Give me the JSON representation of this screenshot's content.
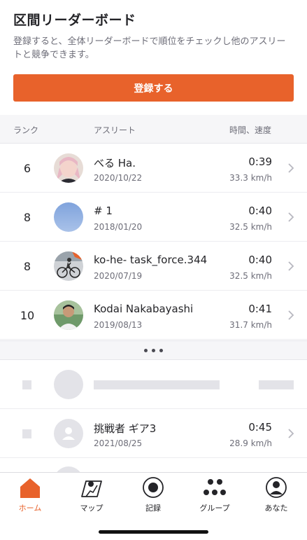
{
  "promo": {
    "title": "区間リーダーボード",
    "description": "登録すると、全体リーダーボードで順位をチェックし他のアスリートと競争できます。",
    "register_label": "登録する"
  },
  "columns": {
    "rank": "ランク",
    "athlete": "アスリート",
    "time_speed": "時間、速度"
  },
  "rows": [
    {
      "rank": "6",
      "name": "べる Ha.",
      "date": "2020/10/22",
      "time": "0:39",
      "speed": "33.3 km/h",
      "avatar": "anime-character-avatar"
    },
    {
      "rank": "8",
      "name": "# 1",
      "date": "2018/01/20",
      "time": "0:40",
      "speed": "32.5 km/h",
      "avatar": "sky-avatar"
    },
    {
      "rank": "8",
      "name": "ko-he- task_force.344",
      "date": "2020/07/19",
      "time": "0:40",
      "speed": "32.5 km/h",
      "avatar": "cyclist-avatar"
    },
    {
      "rank": "10",
      "name": "Kodai Nakabayashi",
      "date": "2019/08/13",
      "time": "0:41",
      "speed": "31.7 km/h",
      "avatar": "person-avatar"
    }
  ],
  "challenger": {
    "name": "挑戦者 ギア3",
    "date": "2021/08/25",
    "time": "0:45",
    "speed": "28.9 km/h"
  },
  "tabs": [
    {
      "label": "ホーム",
      "icon": "home-icon",
      "active": true
    },
    {
      "label": "マップ",
      "icon": "map-icon",
      "active": false
    },
    {
      "label": "記録",
      "icon": "record-icon",
      "active": false
    },
    {
      "label": "グループ",
      "icon": "groups-icon",
      "active": false
    },
    {
      "label": "あなた",
      "icon": "profile-icon",
      "active": false
    }
  ],
  "colors": {
    "accent": "#e8622b",
    "text": "#242428",
    "muted": "#6d6d78",
    "placeholder": "#e3e3e8"
  }
}
